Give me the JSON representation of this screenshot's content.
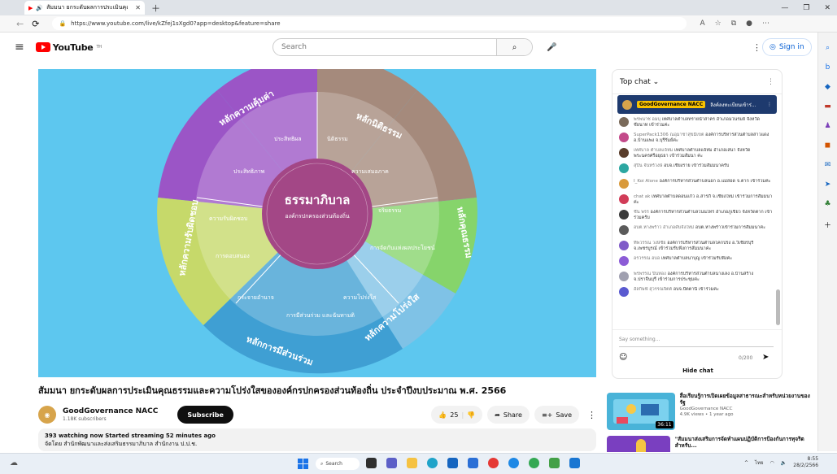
{
  "browser": {
    "tab_title": "สัมมนา ยกระดับผลการประเมินคุณ",
    "url": "https://www.youtube.com/live/kZfej1sXgd0?app=desktop&feature=share"
  },
  "header": {
    "logo_text": "YouTube",
    "logo_sup": "TH",
    "search_placeholder": "Search",
    "sign_in": "Sign in"
  },
  "video": {
    "center_title": "ธรรมาภิบาล",
    "center_subtitle": "องค์กรปกครองส่วนท้องถิ่น",
    "outer_labels": [
      "หลักความคุ้มค่า",
      "หลักนิติธรรม",
      "หลักคุณธรรม",
      "หลักความโปร่งใส",
      "หลักการมีส่วนร่วม",
      "หลักความรับผิดชอบ"
    ],
    "inner_labels": [
      "ประสิทธิผล",
      "นิติธรรม",
      "ประสิทธิภาพ",
      "ความเสมอภาค",
      "ความรับผิดชอบ",
      "จริยธรรม",
      "การตอบสนอง",
      "การจัดกับแห่งผลประโยชน์",
      "กระจายอำนาจ",
      "ความโปร่งใส",
      "การมีส่วนร่วม และฉันทามติ"
    ],
    "title": "สัมมนา ยกระดับผลการประเมินคุณธรรมและความโปร่งใสขององค์กรปกครองส่วนท้องถิ่น ประจำปีงบประมาณ พ.ศ. 2566",
    "channel": "GoodGovernance NACC",
    "subscribers": "1.18K subscribers",
    "subscribe": "Subscribe",
    "likes": "25",
    "share": "Share",
    "save": "Save",
    "desc_line1": "393 watching now  Started streaming 52 minutes ago",
    "desc_line2": "จัดโดย สำนักพัฒนาและส่งเสริมธรรมาภิบาล สำนักงาน ป.ป.ช."
  },
  "chat": {
    "header": "Top chat",
    "pinned_author": "GoodGovernance NACC",
    "pinned_text": "ลิงค์ลงทะเบียนเข้าร่...",
    "messages": [
      {
        "author": "พรพนาช อมบุ",
        "text": "เทศบาลตำบลทรายน้ำสาคร อำเภอมโนรมย์ จังหวัดชัยนาท เข้าร่วมค่ะ",
        "color": "#7a6a5a"
      },
      {
        "author": "SuperPack1306 ณอุมาชาสุขมีเขต",
        "text": "องค์การบริหารส่วนตำบลสาวแดง อ.บ้านแพง จ.บุรีรัมย์ค่ะ",
        "color": "#c34a8a"
      },
      {
        "author": "เทศบาล ตำบลแจ้ห่ม",
        "text": "เทศบาลตำบลแจ้ห่ม อำเภอเสนา จังหวัดพระนครศรีอยุธยา เข้าร่วมสัมนา ค่ะ",
        "color": "#5a3d2b"
      },
      {
        "author": "สุปิน จันทร์วงษ์",
        "text": "อบจ.เชียงราย เข้าร่วมสัมมนาครับ",
        "color": "#2ca7a1"
      },
      {
        "author": "I_Koi Alone",
        "text": "องค์การบริหารส่วนตำบลนอก อ.แม่สอด จ.ตาก เข้าร่วมค่ะ",
        "color": "#d99a3c"
      },
      {
        "author": "chat ak",
        "text": "เทศบาลตำบลดอนแก้ว อ.สารภี จ.เชียงใหม่ เข้าร่วมการสัมมนาค่ะ",
        "color": "#d13c58"
      },
      {
        "author": "ชัน พรร",
        "text": "องค์การบริหารส่วนตำบลโนนไทร อำเภอภูเขียว จังหวัดตาก เข้าร่วมครับ",
        "color": "#3a3a3a"
      },
      {
        "author": "อบต.หางพร้าว อำเภอดับจังใหม่",
        "text": "อบต.หางพร้าวเข้าร่วมการสัมมนาค่ะ",
        "color": "#5b5b5b"
      },
      {
        "author": "ทิพวรรณ วงษ์ชัย",
        "text": "องค์การบริหารส่วนตำบลโคกปรง อ.วิเชียรบุรี จ.เพชรบูรณ์ เข้าร่วมรับฟังการสัมมนาค่ะ",
        "color": "#7f5bc8"
      },
      {
        "author": "อรวรรณ อบอ",
        "text": "เทศบาลตำบลนาบุญ เข้าร่วมรับฟังค่ะ",
        "color": "#8c5cd6"
      },
      {
        "author": "พรพรรณ ปิ่นทอง",
        "text": "องค์การบริหารส่วนตำบลนางเลง อ.บ้านสร้าง จ.ปราจีนบุรี เข้าร่วมการประชุมค่ะ",
        "color": "#a0a0b0"
      },
      {
        "author": "อัลกิษฟ์ สุวรรณจิตต์",
        "text": "อบจ.ปัตตานี เข้าร่วมค่ะ",
        "color": "#5a5ad0"
      }
    ],
    "input_placeholder": "Say something...",
    "counter": "0/200",
    "hide": "Hide chat"
  },
  "recommendations": [
    {
      "title": "สื่อเรียนรู้การเปิดเผยข้อมูลสาธารณะสำหรับหน่วยงานของรัฐ",
      "channel": "GoodGovernance NACC",
      "meta": "4.9K views • 1 year ago",
      "duration": "36:11"
    },
    {
      "title": "\"สัมมนาส่งเสริมการจัดทำแผนปฏิบัติการป้องกันการทุจริตสำหรับ...",
      "channel": "",
      "meta": "",
      "duration": ""
    }
  ],
  "taskbar": {
    "search": "Search",
    "lang": "ไทย",
    "time": "8:55",
    "date": "28/2/2566"
  }
}
